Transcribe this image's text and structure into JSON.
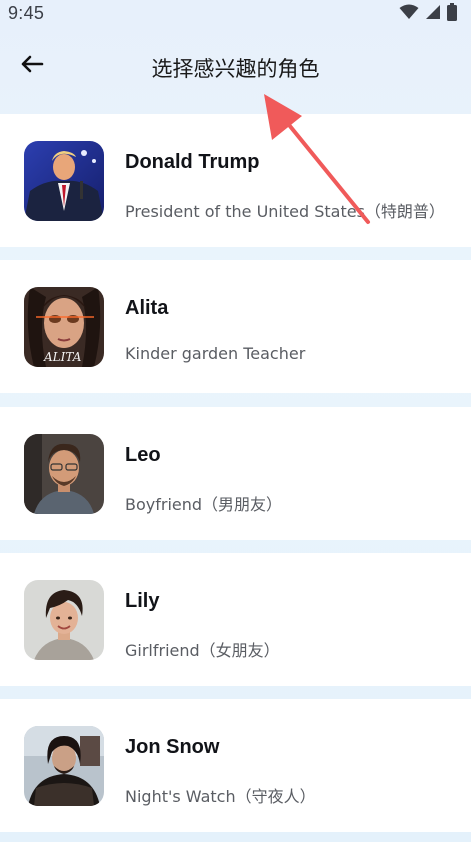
{
  "status_bar": {
    "time": "9:45",
    "icons": [
      "wifi-icon",
      "signal-icon",
      "battery-icon"
    ]
  },
  "header": {
    "back_icon": "arrow-left-icon",
    "title": "选择感兴趣的角色"
  },
  "characters": [
    {
      "name": "Donald Trump",
      "description": "President of the United States（特朗普）",
      "avatar": "avatar-donald-trump"
    },
    {
      "name": "Alita",
      "description": "Kinder garden Teacher",
      "avatar": "avatar-alita"
    },
    {
      "name": "Leo",
      "description": "Boyfriend（男朋友）",
      "avatar": "avatar-leo"
    },
    {
      "name": "Lily",
      "description": "Girlfriend（女朋友）",
      "avatar": "avatar-lily"
    },
    {
      "name": "Jon Snow",
      "description": "Night's Watch（守夜人）",
      "avatar": "avatar-jon-snow"
    }
  ],
  "colors": {
    "background_top": "#e7f0fb",
    "card": "#ffffff",
    "annotation_arrow": "#f05a5a"
  }
}
